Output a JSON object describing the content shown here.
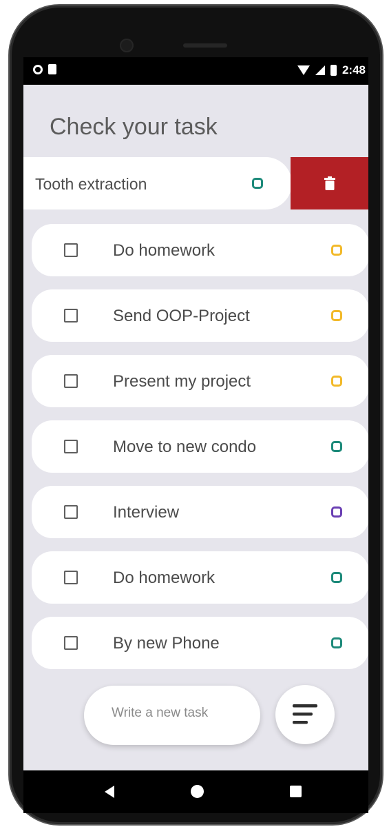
{
  "status_bar": {
    "time": "2:48"
  },
  "header": {
    "title": "Check your task"
  },
  "swiped_task": {
    "label": "Tooth extraction",
    "tag_color": "#1d8a7a",
    "delete_color": "#b32025",
    "delete_icon": "trash-icon"
  },
  "tasks": [
    {
      "label": "Do homework",
      "checked": false,
      "tag_color": "#f2b929"
    },
    {
      "label": "Send OOP-Project",
      "checked": false,
      "tag_color": "#f2b929"
    },
    {
      "label": "Present my project",
      "checked": false,
      "tag_color": "#f2b929"
    },
    {
      "label": "Move to new condo",
      "checked": false,
      "tag_color": "#1d8a7a"
    },
    {
      "label": "Interview",
      "checked": false,
      "tag_color": "#6a3fb3"
    },
    {
      "label": "Do homework",
      "checked": false,
      "tag_color": "#1d8a7a"
    },
    {
      "label": "By new Phone",
      "checked": false,
      "tag_color": "#1d8a7a"
    }
  ],
  "composer": {
    "placeholder": "Write a new task",
    "sort_icon": "sort-lines-icon"
  },
  "navigation": {
    "back_icon": "back-icon",
    "home_icon": "home-icon",
    "recent_icon": "recent-apps-icon"
  }
}
